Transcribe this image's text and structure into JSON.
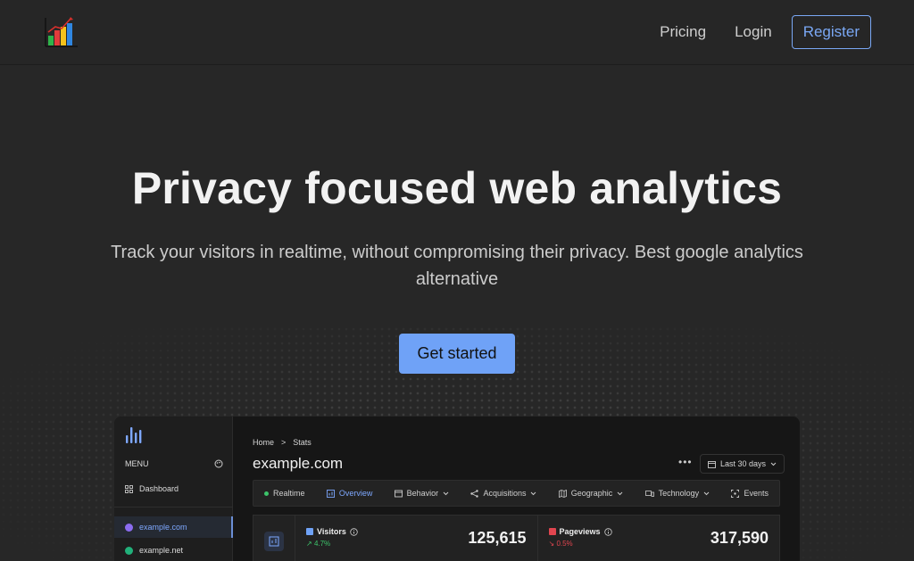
{
  "nav": {
    "pricing": "Pricing",
    "login": "Login",
    "register": "Register"
  },
  "hero": {
    "title": "Privacy focused web analytics",
    "subtitle": "Track your visitors in realtime, without compromising their privacy. Best google analytics alternative",
    "cta": "Get started"
  },
  "preview": {
    "sidebar": {
      "menu_label": "MENU",
      "dashboard": "Dashboard",
      "sites": [
        {
          "label": "example.com",
          "active": true,
          "color": "#8b6cf0"
        },
        {
          "label": "example.net",
          "active": false,
          "color": "#21b07a"
        }
      ]
    },
    "breadcrumb": {
      "home": "Home",
      "separator": ">",
      "current": "Stats"
    },
    "site_title": "example.com",
    "more": "•••",
    "date_range": "Last 30 days",
    "tabs": [
      {
        "label": "Realtime",
        "icon": "live-dot-icon"
      },
      {
        "label": "Overview",
        "icon": "chart-icon",
        "active": true
      },
      {
        "label": "Behavior",
        "icon": "window-icon",
        "dropdown": true
      },
      {
        "label": "Acquisitions",
        "icon": "share-icon",
        "dropdown": true
      },
      {
        "label": "Geographic",
        "icon": "map-icon",
        "dropdown": true
      },
      {
        "label": "Technology",
        "icon": "devices-icon",
        "dropdown": true
      },
      {
        "label": "Events",
        "icon": "focus-icon"
      }
    ],
    "stats": [
      {
        "name": "Visitors",
        "delta": "4.7%",
        "trend": "up",
        "value": "125,615",
        "color": "#6fa2f7"
      },
      {
        "name": "Pageviews",
        "delta": "0.5%",
        "trend": "down",
        "value": "317,590",
        "color": "#e0454f"
      }
    ]
  },
  "colors": {
    "accent": "#6fa2f7",
    "background": "#272727",
    "positive": "#3cc46a",
    "negative": "#e0454f"
  }
}
